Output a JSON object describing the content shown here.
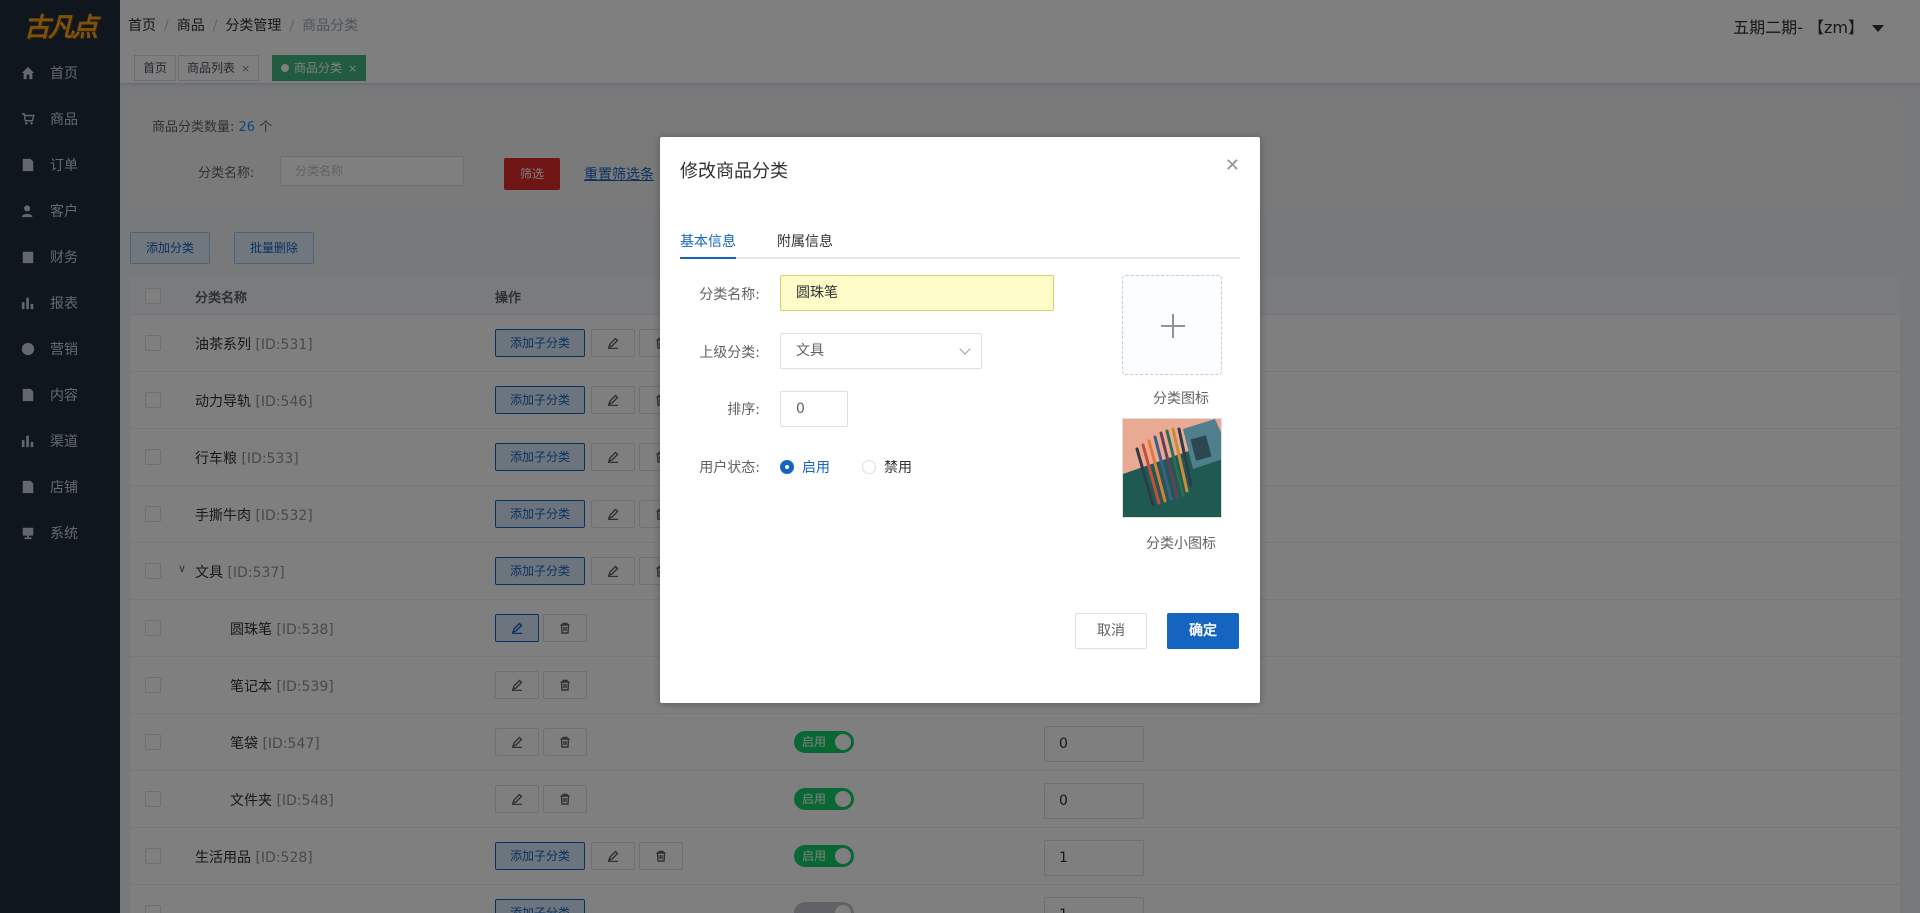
{
  "logo_text": "古凡点",
  "sidebar": {
    "items": [
      {
        "label": "首页",
        "icon": "home-icon"
      },
      {
        "label": "商品",
        "icon": "cart-icon"
      },
      {
        "label": "订单",
        "icon": "order-icon"
      },
      {
        "label": "客户",
        "icon": "user-icon"
      },
      {
        "label": "财务",
        "icon": "wallet-icon"
      },
      {
        "label": "报表",
        "icon": "chart-icon"
      },
      {
        "label": "营销",
        "icon": "marketing-icon"
      },
      {
        "label": "内容",
        "icon": "document-icon"
      },
      {
        "label": "渠道",
        "icon": "channel-chart-icon"
      },
      {
        "label": "店铺",
        "icon": "store-icon"
      },
      {
        "label": "系统",
        "icon": "system-icon"
      }
    ]
  },
  "header": {
    "breadcrumb": [
      "首页",
      "商品",
      "分类管理",
      "商品分类"
    ],
    "user": "五期二期- 【zm】"
  },
  "tags": [
    {
      "label": "首页"
    },
    {
      "label": "商品列表"
    },
    {
      "label": "商品分类"
    }
  ],
  "filter": {
    "count_label": "商品分类数量:",
    "count_value": "26",
    "count_unit": "个",
    "name_label": "分类名称:",
    "name_placeholder": "分类名称",
    "filter_button": "筛选",
    "reset_link": "重置筛选条"
  },
  "actions": {
    "add": "添加分类",
    "batch_delete": "批量删除"
  },
  "table": {
    "headers": {
      "name": "分类名称",
      "operation": "操作"
    },
    "add_child_label": "添加子分类",
    "rows": [
      {
        "name": "油茶系列",
        "id": "[ID:531]"
      },
      {
        "name": "动力导轨",
        "id": "[ID:546]"
      },
      {
        "name": "行车粮",
        "id": "[ID:533]"
      },
      {
        "name": "手撕牛肉",
        "id": "[ID:532]"
      },
      {
        "name": "文具",
        "id": "[ID:537]",
        "expander": "∨"
      },
      {
        "name": "圆珠笔",
        "id": "[ID:538]"
      },
      {
        "name": "笔记本",
        "id": "[ID:539]"
      },
      {
        "name": "笔袋",
        "id": "[ID:547]",
        "status": "启用",
        "sort": "0"
      },
      {
        "name": "文件夹",
        "id": "[ID:548]",
        "status": "启用",
        "sort": "0"
      },
      {
        "name": "生活用品",
        "id": "[ID:528]",
        "status": "启用",
        "sort": "1"
      },
      {
        "name": "",
        "id": "",
        "sort": "1"
      }
    ]
  },
  "dialog": {
    "title": "修改商品分类",
    "tabs": [
      "基本信息",
      "附属信息"
    ],
    "fields": {
      "name_label": "分类名称:",
      "name_value": "圆珠笔",
      "parent_label": "上级分类:",
      "parent_value": "文具",
      "sort_label": "排序:",
      "sort_value": "0",
      "status_label": "用户状态:",
      "status_enabled": "启用",
      "status_disabled": "禁用",
      "selected_status": "启用"
    },
    "icon_caption": "分类图标",
    "small_icon_caption": "分类小图标",
    "cancel": "取消",
    "confirm": "确定"
  },
  "colors": {
    "sidebar_bg": "#1f2d3d",
    "primary": "#1565c0",
    "active_tag": "#42b983",
    "switch_on": "#13ce66",
    "filter_button": "#e02b2b"
  }
}
